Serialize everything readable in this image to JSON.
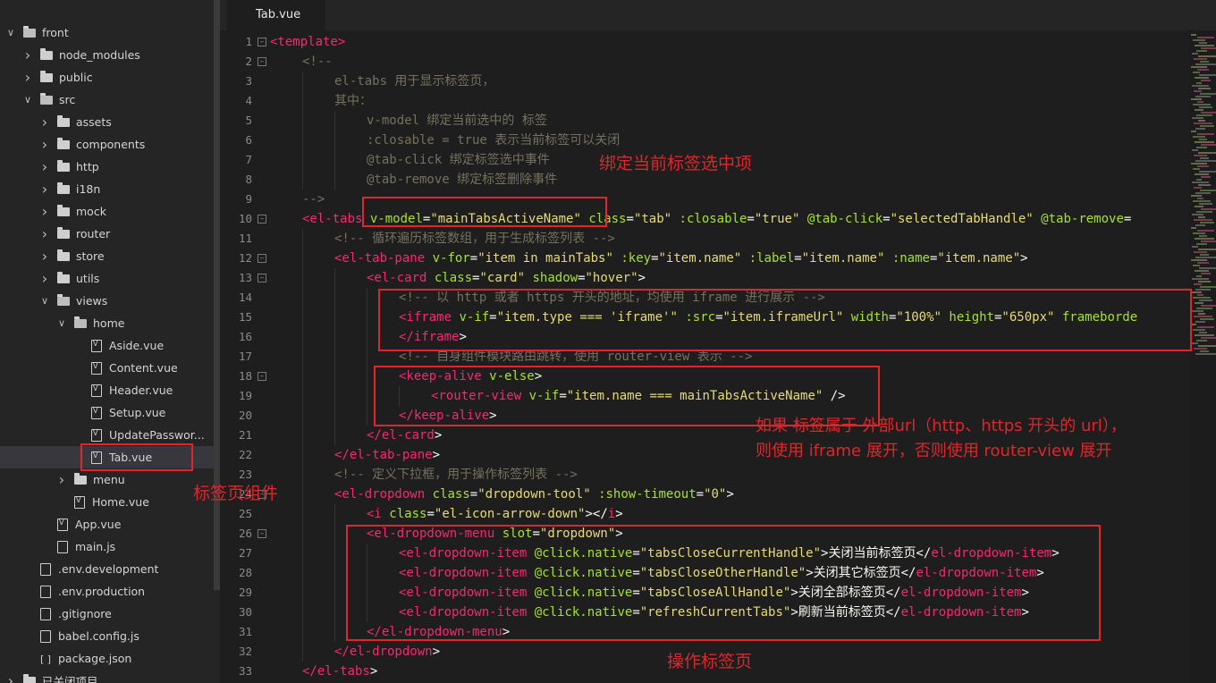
{
  "sidebar": {
    "items": [
      {
        "label": "front",
        "type": "folder-open",
        "depth": 0
      },
      {
        "label": "node_modules",
        "type": "folder",
        "depth": 1
      },
      {
        "label": "public",
        "type": "folder",
        "depth": 1
      },
      {
        "label": "src",
        "type": "folder-open",
        "depth": 1
      },
      {
        "label": "assets",
        "type": "folder",
        "depth": 2
      },
      {
        "label": "components",
        "type": "folder",
        "depth": 2
      },
      {
        "label": "http",
        "type": "folder",
        "depth": 2
      },
      {
        "label": "i18n",
        "type": "folder",
        "depth": 2
      },
      {
        "label": "mock",
        "type": "folder",
        "depth": 2
      },
      {
        "label": "router",
        "type": "folder",
        "depth": 2
      },
      {
        "label": "store",
        "type": "folder",
        "depth": 2
      },
      {
        "label": "utils",
        "type": "folder",
        "depth": 2
      },
      {
        "label": "views",
        "type": "folder-open",
        "depth": 2
      },
      {
        "label": "home",
        "type": "folder-open",
        "depth": 3
      },
      {
        "label": "Aside.vue",
        "type": "vue",
        "depth": 4
      },
      {
        "label": "Content.vue",
        "type": "vue",
        "depth": 4
      },
      {
        "label": "Header.vue",
        "type": "vue",
        "depth": 4
      },
      {
        "label": "Setup.vue",
        "type": "vue",
        "depth": 4
      },
      {
        "label": "UpdatePasswor...",
        "type": "vue",
        "depth": 4
      },
      {
        "label": "Tab.vue",
        "type": "vue",
        "depth": 4,
        "selected": true
      },
      {
        "label": "menu",
        "type": "folder",
        "depth": 3
      },
      {
        "label": "Home.vue",
        "type": "vue",
        "depth": 3
      },
      {
        "label": "App.vue",
        "type": "vue",
        "depth": 2
      },
      {
        "label": "main.js",
        "type": "file",
        "depth": 2
      },
      {
        "label": ".env.development",
        "type": "file",
        "depth": 1
      },
      {
        "label": ".env.production",
        "type": "file",
        "depth": 1
      },
      {
        "label": ".gitignore",
        "type": "file",
        "depth": 1
      },
      {
        "label": "babel.config.js",
        "type": "file",
        "depth": 1
      },
      {
        "label": "package.json",
        "type": "brackets",
        "depth": 1
      },
      {
        "label": "已关闭项目",
        "type": "folder",
        "depth": 0
      }
    ]
  },
  "editor": {
    "tab_label": "Tab.vue",
    "lines": [
      {
        "n": "1",
        "fold": true,
        "indent": 0,
        "tokens": [
          [
            "tag",
            "<template>"
          ]
        ]
      },
      {
        "n": "2",
        "fold": true,
        "indent": 1,
        "tokens": [
          [
            "cmt",
            "<!--"
          ]
        ]
      },
      {
        "n": "3",
        "indent": 2,
        "tokens": [
          [
            "cmt",
            "el-tabs 用于显示标签页，"
          ]
        ]
      },
      {
        "n": "4",
        "indent": 2,
        "tokens": [
          [
            "cmt",
            "其中："
          ]
        ]
      },
      {
        "n": "5",
        "indent": 3,
        "tokens": [
          [
            "cmt",
            "v-model 绑定当前选中的 标签"
          ]
        ]
      },
      {
        "n": "6",
        "indent": 3,
        "tokens": [
          [
            "cmt",
            ":closable = true 表示当前标签可以关闭"
          ]
        ]
      },
      {
        "n": "7",
        "indent": 3,
        "tokens": [
          [
            "cmt",
            "@tab-click 绑定标签选中事件"
          ]
        ]
      },
      {
        "n": "8",
        "indent": 3,
        "tokens": [
          [
            "cmt",
            "@tab-remove 绑定标签删除事件"
          ]
        ]
      },
      {
        "n": "9",
        "indent": 1,
        "tokens": [
          [
            "cmt",
            "-->"
          ]
        ]
      },
      {
        "n": "10",
        "fold": true,
        "indent": 1,
        "tokens": [
          [
            "tag",
            "<el-tabs"
          ],
          [
            "txt",
            " "
          ],
          [
            "attr",
            "v-model"
          ],
          [
            "txt",
            "="
          ],
          [
            "str",
            "\"mainTabsActiveName\""
          ],
          [
            "txt",
            " "
          ],
          [
            "attr",
            "class"
          ],
          [
            "txt",
            "="
          ],
          [
            "str",
            "\"tab\""
          ],
          [
            "txt",
            " "
          ],
          [
            "attr",
            ":closable"
          ],
          [
            "txt",
            "="
          ],
          [
            "str",
            "\"true\""
          ],
          [
            "txt",
            " "
          ],
          [
            "attr",
            "@tab-click"
          ],
          [
            "txt",
            "="
          ],
          [
            "str",
            "\"selectedTabHandle\""
          ],
          [
            "txt",
            " "
          ],
          [
            "attr",
            "@tab-remove"
          ],
          [
            "txt",
            "="
          ]
        ]
      },
      {
        "n": "11",
        "indent": 2,
        "tokens": [
          [
            "cmt",
            "<!-- 循环遍历标签数组，用于生成标签列表 -->"
          ]
        ]
      },
      {
        "n": "12",
        "fold": true,
        "indent": 2,
        "tokens": [
          [
            "tag",
            "<el-tab-pane"
          ],
          [
            "txt",
            " "
          ],
          [
            "attr",
            "v-for"
          ],
          [
            "txt",
            "="
          ],
          [
            "str",
            "\"item in mainTabs\""
          ],
          [
            "txt",
            " "
          ],
          [
            "attr",
            ":key"
          ],
          [
            "txt",
            "="
          ],
          [
            "str",
            "\"item.name\""
          ],
          [
            "txt",
            " "
          ],
          [
            "attr",
            ":label"
          ],
          [
            "txt",
            "="
          ],
          [
            "str",
            "\"item.name\""
          ],
          [
            "txt",
            " "
          ],
          [
            "attr",
            ":name"
          ],
          [
            "txt",
            "="
          ],
          [
            "str",
            "\"item.name\""
          ],
          [
            "txt",
            ">"
          ]
        ]
      },
      {
        "n": "13",
        "fold": true,
        "indent": 3,
        "tokens": [
          [
            "tag",
            "<el-card"
          ],
          [
            "txt",
            " "
          ],
          [
            "attr",
            "class"
          ],
          [
            "txt",
            "="
          ],
          [
            "str",
            "\"card\""
          ],
          [
            "txt",
            " "
          ],
          [
            "attr",
            "shadow"
          ],
          [
            "txt",
            "="
          ],
          [
            "str",
            "\"hover\""
          ],
          [
            "txt",
            ">"
          ]
        ]
      },
      {
        "n": "14",
        "indent": 4,
        "tokens": [
          [
            "cmt",
            "<!-- 以 http 或者 https 开头的地址，均使用 iframe 进行展示 -->"
          ]
        ]
      },
      {
        "n": "15",
        "indent": 4,
        "tokens": [
          [
            "tag",
            "<iframe"
          ],
          [
            "txt",
            " "
          ],
          [
            "attr",
            "v-if"
          ],
          [
            "txt",
            "="
          ],
          [
            "str",
            "\"item.type === 'iframe'\""
          ],
          [
            "txt",
            " "
          ],
          [
            "attr",
            ":src"
          ],
          [
            "txt",
            "="
          ],
          [
            "str",
            "\"item.iframeUrl\""
          ],
          [
            "txt",
            " "
          ],
          [
            "attr",
            "width"
          ],
          [
            "txt",
            "="
          ],
          [
            "str",
            "\"100%\""
          ],
          [
            "txt",
            " "
          ],
          [
            "attr",
            "height"
          ],
          [
            "txt",
            "="
          ],
          [
            "str",
            "\"650px\""
          ],
          [
            "txt",
            " "
          ],
          [
            "attr",
            "frameborde"
          ]
        ]
      },
      {
        "n": "16",
        "indent": 4,
        "tokens": [
          [
            "tag",
            "</iframe"
          ],
          [
            "txt",
            ">"
          ]
        ]
      },
      {
        "n": "17",
        "indent": 4,
        "tokens": [
          [
            "cmt",
            "<!-- 自身组件模块路由跳转，使用 router-view 表示 -->"
          ]
        ]
      },
      {
        "n": "18",
        "fold": true,
        "indent": 4,
        "tokens": [
          [
            "tag",
            "<keep-alive"
          ],
          [
            "txt",
            " "
          ],
          [
            "attr",
            "v-else"
          ],
          [
            "txt",
            ">"
          ]
        ]
      },
      {
        "n": "19",
        "indent": 5,
        "tokens": [
          [
            "tag",
            "<router-view"
          ],
          [
            "txt",
            " "
          ],
          [
            "attr",
            "v-if"
          ],
          [
            "txt",
            "="
          ],
          [
            "str",
            "\"item.name === mainTabsActiveName\""
          ],
          [
            "txt",
            " />"
          ]
        ]
      },
      {
        "n": "20",
        "indent": 4,
        "tokens": [
          [
            "tag",
            "</keep-alive"
          ],
          [
            "txt",
            ">"
          ]
        ]
      },
      {
        "n": "21",
        "indent": 3,
        "tokens": [
          [
            "tag",
            "</el-card"
          ],
          [
            "txt",
            ">"
          ]
        ]
      },
      {
        "n": "22",
        "indent": 2,
        "tokens": [
          [
            "tag",
            "</el-tab-pane"
          ],
          [
            "txt",
            ">"
          ]
        ]
      },
      {
        "n": "23",
        "indent": 2,
        "tokens": [
          [
            "cmt",
            "<!-- 定义下拉框，用于操作标签列表 -->"
          ]
        ]
      },
      {
        "n": "24",
        "fold": true,
        "indent": 2,
        "tokens": [
          [
            "tag",
            "<el-dropdown"
          ],
          [
            "txt",
            " "
          ],
          [
            "attr",
            "class"
          ],
          [
            "txt",
            "="
          ],
          [
            "str",
            "\"dropdown-tool\""
          ],
          [
            "txt",
            " "
          ],
          [
            "attr",
            ":show-timeout"
          ],
          [
            "txt",
            "="
          ],
          [
            "str",
            "\"0\""
          ],
          [
            "txt",
            ">"
          ]
        ]
      },
      {
        "n": "25",
        "indent": 3,
        "tokens": [
          [
            "tag",
            "<i"
          ],
          [
            "txt",
            " "
          ],
          [
            "attr",
            "class"
          ],
          [
            "txt",
            "="
          ],
          [
            "str",
            "\"el-icon-arrow-down\""
          ],
          [
            "txt",
            "></"
          ],
          [
            "tag",
            "i"
          ],
          [
            "txt",
            ">"
          ]
        ]
      },
      {
        "n": "26",
        "fold": true,
        "indent": 3,
        "tokens": [
          [
            "tag",
            "<el-dropdown-menu"
          ],
          [
            "txt",
            " "
          ],
          [
            "attr",
            "slot"
          ],
          [
            "txt",
            "="
          ],
          [
            "str",
            "\"dropdown\""
          ],
          [
            "txt",
            ">"
          ]
        ]
      },
      {
        "n": "27",
        "indent": 4,
        "tokens": [
          [
            "tag",
            "<el-dropdown-item"
          ],
          [
            "txt",
            " "
          ],
          [
            "attr",
            "@click.native"
          ],
          [
            "txt",
            "="
          ],
          [
            "str",
            "\"tabsCloseCurrentHandle\""
          ],
          [
            "txt",
            ">关闭当前标签页</"
          ],
          [
            "tag",
            "el-dropdown-item"
          ],
          [
            "txt",
            ">"
          ]
        ]
      },
      {
        "n": "28",
        "indent": 4,
        "tokens": [
          [
            "tag",
            "<el-dropdown-item"
          ],
          [
            "txt",
            " "
          ],
          [
            "attr",
            "@click.native"
          ],
          [
            "txt",
            "="
          ],
          [
            "str",
            "\"tabsCloseOtherHandle\""
          ],
          [
            "txt",
            ">关闭其它标签页</"
          ],
          [
            "tag",
            "el-dropdown-item"
          ],
          [
            "txt",
            ">"
          ]
        ]
      },
      {
        "n": "29",
        "indent": 4,
        "tokens": [
          [
            "tag",
            "<el-dropdown-item"
          ],
          [
            "txt",
            " "
          ],
          [
            "attr",
            "@click.native"
          ],
          [
            "txt",
            "="
          ],
          [
            "str",
            "\"tabsCloseAllHandle\""
          ],
          [
            "txt",
            ">关闭全部标签页</"
          ],
          [
            "tag",
            "el-dropdown-item"
          ],
          [
            "txt",
            ">"
          ]
        ]
      },
      {
        "n": "30",
        "indent": 4,
        "tokens": [
          [
            "tag",
            "<el-dropdown-item"
          ],
          [
            "txt",
            " "
          ],
          [
            "attr",
            "@click.native"
          ],
          [
            "txt",
            "="
          ],
          [
            "str",
            "\"refreshCurrentTabs\""
          ],
          [
            "txt",
            ">刷新当前标签页</"
          ],
          [
            "tag",
            "el-dropdown-item"
          ],
          [
            "txt",
            ">"
          ]
        ]
      },
      {
        "n": "31",
        "indent": 3,
        "tokens": [
          [
            "tag",
            "</el-dropdown-menu"
          ],
          [
            "txt",
            ">"
          ]
        ]
      },
      {
        "n": "32",
        "indent": 2,
        "tokens": [
          [
            "tag",
            "</el-dropdown"
          ],
          [
            "txt",
            ">"
          ]
        ]
      },
      {
        "n": "33",
        "indent": 1,
        "tokens": [
          [
            "tag",
            "</el-tabs"
          ],
          [
            "txt",
            ">"
          ]
        ]
      }
    ]
  },
  "annotations": {
    "bind_tab": "绑定当前标签选中项",
    "iframe_note_1": "如果 标签属于 外部url（http、https 开头的 url），",
    "iframe_note_2": "则使用 iframe 展开，否则使用 router-view 展开",
    "tab_component": "标签页组件",
    "operate_tabs": "操作标签页"
  },
  "colors": {
    "tag": "#f92672",
    "attr": "#a6e22e",
    "string": "#e6db74",
    "comment": "#75715e",
    "annotation": "#e0252b"
  }
}
